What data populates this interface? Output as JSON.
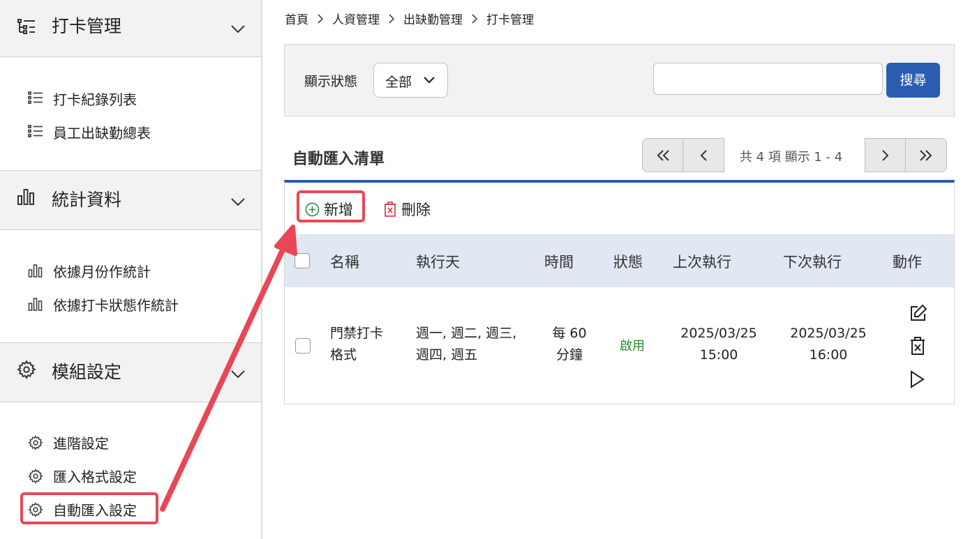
{
  "sidebar": {
    "sections": [
      {
        "title": "打卡管理",
        "items": [
          "打卡紀錄列表",
          "員工出缺勤總表"
        ]
      },
      {
        "title": "統計資料",
        "items": [
          "依據月份作統計",
          "依據打卡狀態作統計"
        ]
      },
      {
        "title": "模組設定",
        "items": [
          "進階設定",
          "匯入格式設定",
          "自動匯入設定"
        ]
      }
    ]
  },
  "breadcrumb": [
    "首頁",
    "人資管理",
    "出缺勤管理",
    "打卡管理"
  ],
  "filter": {
    "label": "顯示狀態",
    "selected": "全部",
    "search_value": "",
    "search_button": "搜尋"
  },
  "list": {
    "title": "自動匯入清單",
    "pagination": {
      "info": "共 4 項 顯示 1 - 4"
    },
    "toolbar": {
      "add": "新增",
      "delete": "刪除"
    },
    "columns": [
      "名稱",
      "執行天",
      "時間",
      "狀態",
      "上次執行",
      "下次執行",
      "動作"
    ],
    "rows": [
      {
        "name_lines": [
          "門禁打卡",
          "格式"
        ],
        "days_lines": [
          "週一, 週二, 週三,",
          "週四, 週五"
        ],
        "time_lines": [
          "每 60",
          "分鐘"
        ],
        "status": "啟用",
        "last_lines": [
          "2025/03/25",
          "15:00"
        ],
        "next_lines": [
          "2025/03/25",
          "16:00"
        ]
      }
    ]
  },
  "colors": {
    "primary": "#2a5db0",
    "highlight": "#e84855",
    "status_enabled": "#2a8a2a",
    "table_header": "#e1e8f3"
  }
}
